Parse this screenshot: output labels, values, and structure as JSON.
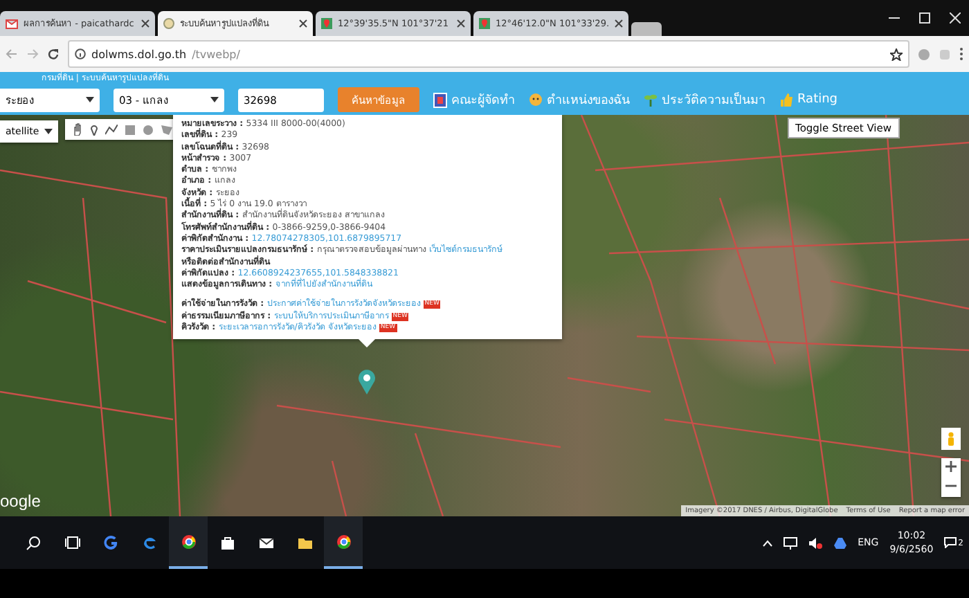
{
  "browser": {
    "tabs": [
      {
        "kind": "mail",
        "title": "ผลการค้นหา - paicathardc",
        "selected": false
      },
      {
        "kind": "site",
        "title": "ระบบค้นหารูปแปลงที่ดิน",
        "selected": true
      },
      {
        "kind": "maps",
        "title": "12°39'35.5\"N 101°37'21",
        "selected": false
      },
      {
        "kind": "maps",
        "title": "12°46'12.0\"N 101°33'29.",
        "selected": false
      }
    ],
    "address": {
      "host": "dolwms.dol.go.th",
      "path": "/tvwebp/"
    }
  },
  "header": {
    "title": "กรมที่ดิน | ระบบค้นหารูปแปลงที่ดิน"
  },
  "toolbar": {
    "province": "ระยอง",
    "district": "03 - แกลง",
    "parcel_number": "32698",
    "search_button": "ค้นหาข้อมูล",
    "links": [
      {
        "kind": "team",
        "label": "คณะผู้จัดทำ"
      },
      {
        "kind": "location",
        "label": "ตำแหน่งของฉัน"
      },
      {
        "kind": "history",
        "label": "ประวัติความเป็นมา"
      },
      {
        "kind": "rating",
        "label": "Rating"
      }
    ]
  },
  "map": {
    "map_type": "atellite",
    "street_view_button": "Toggle Street View",
    "logo": "oogle",
    "attribution": [
      "Imagery ©2017 DNES / Airbus, DigitalGlobe",
      "Terms of Use",
      "Report a map error"
    ],
    "popup": {
      "rows": [
        {
          "kind": "field",
          "label": "หมายเลขระวาง :",
          "value": "5334 III 8000-00(4000)"
        },
        {
          "kind": "field",
          "label": "เลขที่ดิน :",
          "value": "239"
        },
        {
          "kind": "field",
          "label": "เลขโฉนดที่ดิน :",
          "value": "32698"
        },
        {
          "kind": "field",
          "label": "หน้าสำรวจ :",
          "value": "3007"
        },
        {
          "kind": "field",
          "label": "ตำบล :",
          "value": "ชากพง"
        },
        {
          "kind": "field",
          "label": "อำเภอ :",
          "value": "แกลง"
        },
        {
          "kind": "field",
          "label": "จังหวัด :",
          "value": "ระยอง"
        },
        {
          "kind": "field",
          "label": "เนื้อที่ :",
          "value": "5 ไร่ 0 งาน 19.0 ตารางวา"
        },
        {
          "kind": "field",
          "label": "สำนักงานที่ดิน :",
          "value": "สำนักงานที่ดินจังหวัดระยอง สาขาแกลง"
        },
        {
          "kind": "field",
          "label": "โทรศัพท์สำนักงานที่ดิน :",
          "value": "0-3866-9259,0-3866-9404"
        },
        {
          "kind": "field",
          "label": "ค่าพิกัดสำนักงาน :",
          "link": "12.78074278305,101.6879895717"
        },
        {
          "kind": "field",
          "label": "ราคาประเมินรายแปลงกรมธนารักษ์ :",
          "value": "กรุณาตรวจสอบข้อมูลผ่านทาง",
          "link": "เว็บไซต์กรมธนารักษ์"
        },
        {
          "kind": "note",
          "label": "หรือติดต่อสำนักงานที่ดิน"
        },
        {
          "kind": "field",
          "label": "ค่าพิกัดแปลง :",
          "link": "12.6608924237655,101.5848338821"
        },
        {
          "kind": "field",
          "label": "แสดงข้อมูลการเดินทาง :",
          "link": "จากที่ที่ไปยังสำนักงานที่ดิน"
        },
        {
          "kind": "gap"
        },
        {
          "kind": "field",
          "label": "ค่าใช้จ่ายในการรังวัด :",
          "link": "ประกาศค่าใช้จ่ายในการรังวัดจังหวัดระยอง",
          "badge": "NEW"
        },
        {
          "kind": "field",
          "label": "ค่าธรรมเนียมภาษีอากร :",
          "link": "ระบบให้บริการประเมินภาษีอากร",
          "badge": "NEW"
        },
        {
          "kind": "field",
          "label": "คิวรังวัด :",
          "link": "ระยะเวลารอการรังวัด/คิวรังวัด จังหวัดระยอง",
          "badge": "NEW"
        }
      ]
    }
  },
  "taskbar": {
    "apps": [
      {
        "kind": "search"
      },
      {
        "kind": "taskview"
      },
      {
        "kind": "google"
      },
      {
        "kind": "edge"
      },
      {
        "kind": "chrome",
        "selected": true
      },
      {
        "kind": "store"
      },
      {
        "kind": "mail"
      },
      {
        "kind": "files"
      },
      {
        "kind": "chrome",
        "selected": true
      }
    ],
    "language": "ENG",
    "time": "10:02",
    "date": "9/6/2560",
    "notifications": "2"
  }
}
